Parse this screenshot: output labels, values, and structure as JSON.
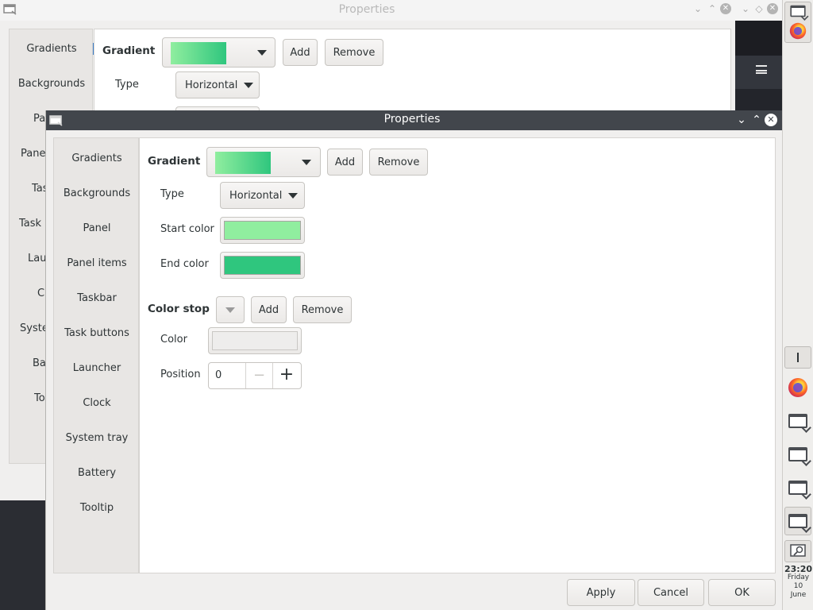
{
  "background_window": {
    "title": "Properties",
    "nav": [
      "Gradients",
      "Backgrounds",
      "Pa",
      "Panel",
      "Tas",
      "Task b",
      "Lau",
      "C",
      "Syste",
      "Ba",
      "To"
    ],
    "gradient_label": "Gradient",
    "add_label": "Add",
    "remove_label": "Remove",
    "type_label": "Type",
    "type_value": "Horizontal"
  },
  "window": {
    "title": "Properties",
    "nav": [
      "Gradients",
      "Backgrounds",
      "Panel",
      "Panel items",
      "Taskbar",
      "Task buttons",
      "Launcher",
      "Clock",
      "System tray",
      "Battery",
      "Tooltip"
    ],
    "active_nav": "Gradients",
    "gradient": {
      "label": "Gradient",
      "add_label": "Add",
      "remove_label": "Remove",
      "type_label": "Type",
      "type_value": "Horizontal",
      "start_label": "Start color",
      "start_color": "#90ee9f",
      "end_label": "End color",
      "end_color": "#2fc67e"
    },
    "color_stop": {
      "label": "Color stop",
      "add_label": "Add",
      "remove_label": "Remove",
      "color_label": "Color",
      "color_value": "#eeedec",
      "position_label": "Position",
      "position_value": "0"
    },
    "footer": {
      "apply_label": "Apply",
      "cancel_label": "Cancel",
      "ok_label": "OK"
    }
  },
  "taskbar": {
    "clock_time": "23:20",
    "clock_day": "Friday",
    "clock_date": "10",
    "clock_month": "June"
  }
}
